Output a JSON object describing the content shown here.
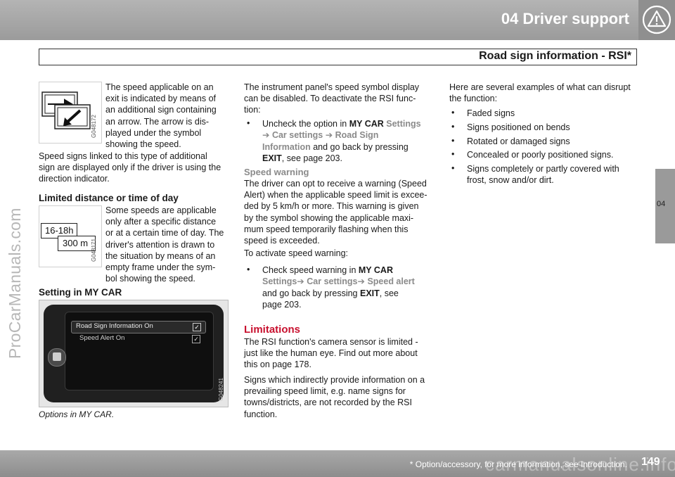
{
  "header": {
    "chapter": "04 Driver support",
    "subtitle": "Road sign information - RSI*",
    "icon": "warning-triangle-icon"
  },
  "side_tab": "04",
  "watermark": "ProCarManuals.com",
  "col1": {
    "p1_lines": [
      "The speed applicable on an",
      "exit is indicated by means of",
      "an additional sign containing",
      "an arrow. The arrow is dis-",
      "played under the symbol",
      "showing the speed."
    ],
    "img1_code": "G048172",
    "p2_lines": [
      "Speed signs linked to this type of additional",
      "sign are displayed only if the driver is using the",
      "direction indicator."
    ],
    "h_limited": "Limited distance or time of day",
    "p3_lines": [
      "Some speeds are applicable",
      "only after a specific distance",
      "or at a certain time of day. The",
      "driver's attention is drawn to",
      "the situation by means of an",
      "empty frame under the sym-",
      "bol showing the speed."
    ],
    "img2_time": "16-18h",
    "img2_dist": "300 m",
    "img2_code": "G048171",
    "h_setting": "Setting in MY CAR",
    "screen_item1": "Road Sign Information On",
    "screen_item2": "Speed Alert On",
    "img3_code": "G048241",
    "caption": "Options in MY CAR."
  },
  "col2": {
    "p1_lines": [
      "The instrument panel's speed symbol display",
      "can be disabled. To deactivate the RSI func-",
      "tion:"
    ],
    "b1_pre": "Uncheck the option in ",
    "b1_mycar": "MY CAR",
    "b1_settings": " Settings",
    "b1_l2a": "➔ Car settings",
    "b1_l2b": "➔ Road Sign",
    "b1_l3a": "Information",
    "b1_l3b": " and go back by pressing",
    "b1_exit": "EXIT",
    "b1_l4": ", see page 203.",
    "h_warning": "Speed warning",
    "p2_lines": [
      "The driver can opt to receive a warning (Speed",
      "Alert) when the applicable speed limit is excee-",
      "ded by 5 km/h or more. This warning is given",
      "by the symbol showing the applicable maxi-",
      "mum speed temporarily flashing when this",
      "speed is exceeded."
    ],
    "p3": "To activate speed warning:",
    "b2_pre": "Check speed warning in ",
    "b2_mycar": "MY CAR",
    "b2_l2": "Settings➔ Car settings➔ Speed alert",
    "b2_l3a": "and go back by pressing ",
    "b2_exit": "EXIT",
    "b2_l3b": ", see",
    "b2_l4": "page 203.",
    "h_limitations": "Limitations",
    "p4_lines": [
      "The RSI function's camera sensor is limited -",
      "just like the human eye. Find out more about",
      "this on page 178."
    ],
    "p5_lines": [
      "Signs which indirectly provide information on a",
      "prevailing speed limit, e.g. name signs for",
      "towns/districts, are not recorded by the RSI",
      "function."
    ]
  },
  "col3": {
    "p1_lines": [
      "Here are several examples of what can disrupt",
      "the function:"
    ],
    "bullets": [
      "Faded signs",
      "Signs positioned on bends",
      "Rotated or damaged signs",
      "Concealed or poorly positioned signs.",
      "Signs completely or partly covered with"
    ],
    "bullet5_l2": "frost, snow and/or dirt."
  },
  "footer": {
    "note": "* Option/accessory, for more information, see Introduction.",
    "page": "149",
    "watermark": "carmanualsonline.info"
  },
  "colors": {
    "header_grey": "#a5a5a5",
    "accent_red": "#c8102e",
    "menu_grey": "#8a8a8a"
  }
}
